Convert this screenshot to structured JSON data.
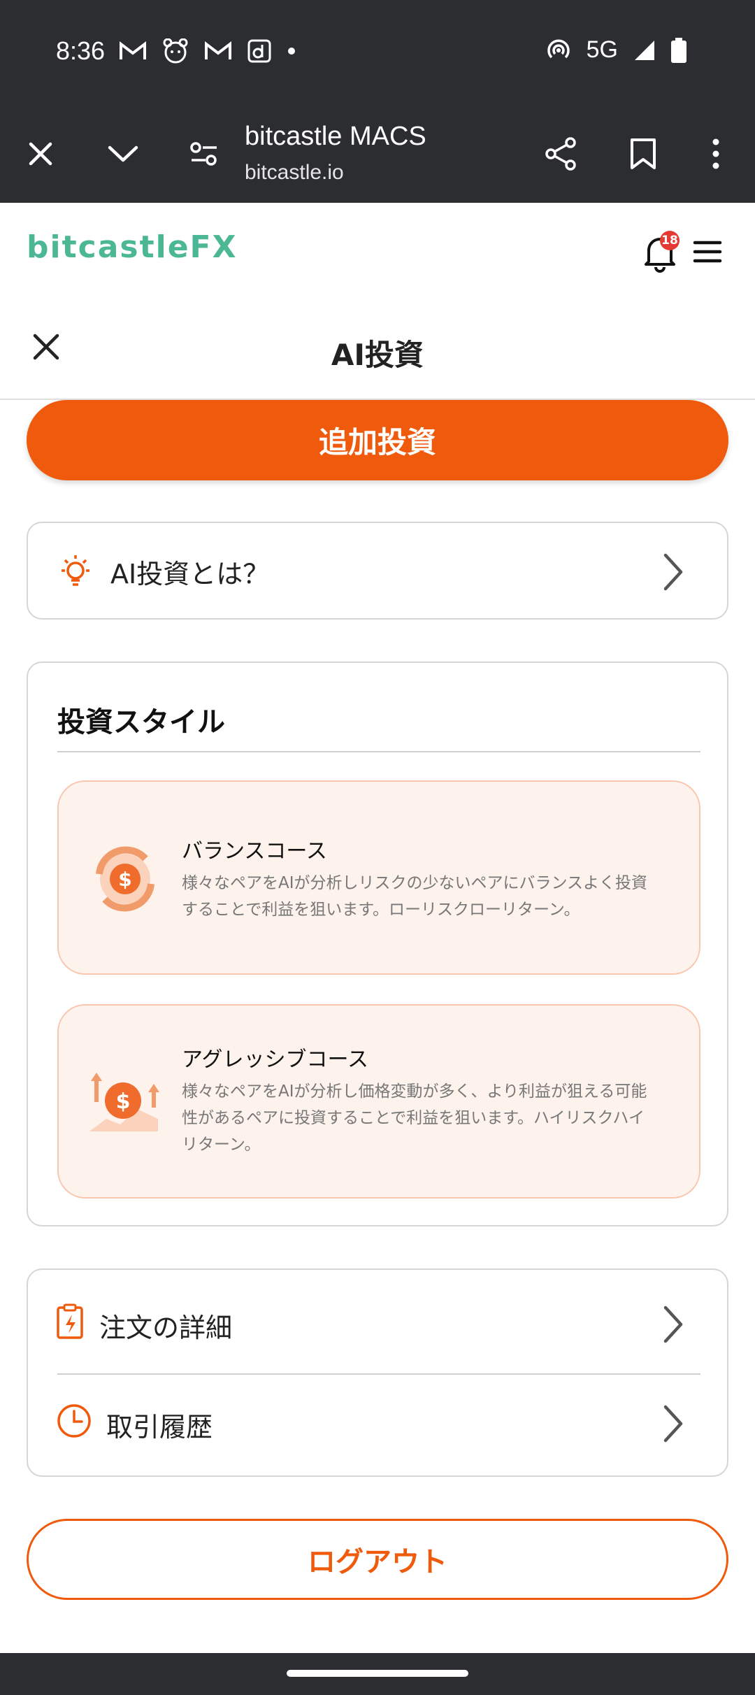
{
  "status_bar": {
    "time": "8:36",
    "network": "5G",
    "icons_left": [
      "gmail-icon",
      "cat-face-icon",
      "gmail-icon",
      "d-app-icon",
      "dot-icon"
    ],
    "icons_right": [
      "hotspot-icon",
      "signal-icon",
      "battery-icon"
    ]
  },
  "browser": {
    "title": "bitcastle MACS",
    "url": "bitcastle.io"
  },
  "app_header": {
    "logo_main": "bitcastle",
    "logo_fx": "FX",
    "notification_count": "18"
  },
  "page": {
    "title": "AI投資"
  },
  "actions": {
    "add_investment": "追加投資",
    "logout": "ログアウト"
  },
  "about": {
    "label": "AI投資とは？"
  },
  "investment_style": {
    "title": "投資スタイル",
    "courses": [
      {
        "name": "バランスコース",
        "desc_line1": "様々なペアをAIが分析しリスクの少ないペアにバランスよく投資",
        "desc_line2": "することで利益を狙います。ローリスクローリターン。",
        "desc_line3": ""
      },
      {
        "name": "アグレッシブコース",
        "desc_line1": "様々なペアをAIが分析し価格変動が多く、より利益が狙える可能",
        "desc_line2": "性があるペアに投資することで利益を狙います。ハイリスクハイ",
        "desc_line3": "リターン。"
      }
    ]
  },
  "links": {
    "order_details": "注文の詳細",
    "trade_history": "取引履歴"
  },
  "colors": {
    "accent": "#ef5a0c",
    "logo": "#4cb795",
    "course_bg": "#fdf3ec"
  }
}
